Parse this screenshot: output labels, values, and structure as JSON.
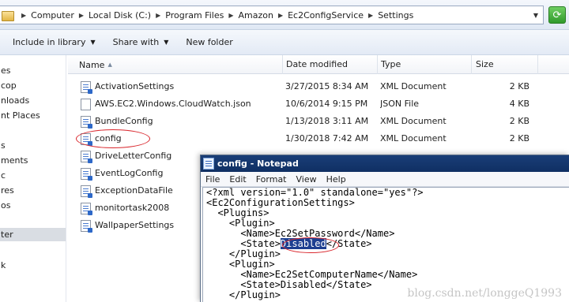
{
  "addressbar": {
    "breadcrumbs": [
      "Computer",
      "Local Disk (C:)",
      "Program Files",
      "Amazon",
      "Ec2ConfigService",
      "Settings"
    ],
    "icons": {
      "folder": "folder-icon",
      "refresh": "refresh-icon"
    }
  },
  "toolbar": {
    "include_in_library": "Include in library",
    "share_with": "Share with",
    "new_folder": "New folder"
  },
  "navpane": {
    "items": [
      "es",
      "cop",
      "nloads",
      "nt Places",
      "s",
      "ments",
      "c",
      "res",
      "os",
      "ter",
      "k"
    ],
    "selected_index": 9
  },
  "filelist": {
    "columns": {
      "name": "Name",
      "date": "Date modified",
      "type": "Type",
      "size": "Size"
    },
    "rows": [
      {
        "name": "ActivationSettings",
        "date": "3/27/2015 8:34 AM",
        "type": "XML Document",
        "size": "2 KB",
        "icon": "xml-file-icon"
      },
      {
        "name": "AWS.EC2.Windows.CloudWatch.json",
        "date": "10/6/2014 9:15 PM",
        "type": "JSON File",
        "size": "4 KB",
        "icon": "json-file-icon"
      },
      {
        "name": "BundleConfig",
        "date": "1/13/2018 3:11 AM",
        "type": "XML Document",
        "size": "2 KB",
        "icon": "xml-file-icon"
      },
      {
        "name": "config",
        "date": "1/30/2018 7:42 AM",
        "type": "XML Document",
        "size": "2 KB",
        "icon": "xml-file-icon"
      },
      {
        "name": "DriveLetterConfig",
        "date": "",
        "type": "",
        "size": "",
        "icon": "xml-file-icon"
      },
      {
        "name": "EventLogConfig",
        "date": "",
        "type": "",
        "size": "",
        "icon": "xml-file-icon"
      },
      {
        "name": "ExceptionDataFile",
        "date": "",
        "type": "",
        "size": "",
        "icon": "xml-file-icon"
      },
      {
        "name": "monitortask2008",
        "date": "",
        "type": "",
        "size": "",
        "icon": "xml-file-icon"
      },
      {
        "name": "WallpaperSettings",
        "date": "",
        "type": "",
        "size": "",
        "icon": "xml-file-icon"
      }
    ]
  },
  "notepad": {
    "title": "config - Notepad",
    "menu": [
      "File",
      "Edit",
      "Format",
      "View",
      "Help"
    ],
    "lines": [
      "<?xml version=\"1.0\" standalone=\"yes\"?>",
      "<Ec2ConfigurationSettings>",
      "  <Plugins>",
      "    <Plugin>",
      "      <Name>Ec2SetPassword</Name>",
      "      <State>Disabled</State>",
      "    </Plugin>",
      "    <Plugin>",
      "      <Name>Ec2SetComputerName</Name>",
      "      <State>Disabled</State>",
      "    </Plugin>"
    ],
    "selected": {
      "line_index": 5,
      "before": "      <State>",
      "text": "Disabled",
      "after": "</State>"
    },
    "watermark": "blog.csdn.net/longgeQ1993"
  },
  "colors": {
    "highlight": "#d9262c",
    "selection": "#1d3f91",
    "title_bar": "#1a3e78"
  }
}
